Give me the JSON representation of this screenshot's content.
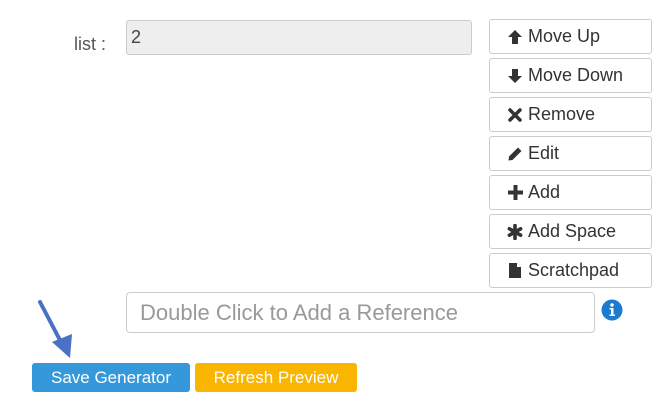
{
  "list": {
    "label": "list :",
    "items": [
      "2"
    ]
  },
  "side_buttons": {
    "move_up": {
      "label": "Move Up",
      "icon": "arrow-up-icon"
    },
    "move_down": {
      "label": "Move Down",
      "icon": "arrow-down-icon"
    },
    "remove": {
      "label": "Remove",
      "icon": "close-icon"
    },
    "edit": {
      "label": "Edit",
      "icon": "pencil-icon"
    },
    "add": {
      "label": "Add",
      "icon": "plus-icon"
    },
    "add_space": {
      "label": "Add Space",
      "icon": "asterisk-icon"
    },
    "scratchpad": {
      "label": "Scratchpad",
      "icon": "file-icon"
    }
  },
  "reference": {
    "placeholder": "Double Click to Add a Reference",
    "value": ""
  },
  "info": {
    "icon": "info-circle-icon",
    "color": "#1a7bd1"
  },
  "actions": {
    "save_label": "Save Generator",
    "refresh_label": "Refresh Preview"
  },
  "colors": {
    "save_button": "#3498db",
    "refresh_button": "#f9b500",
    "annotation_arrow": "#4a72c4"
  }
}
